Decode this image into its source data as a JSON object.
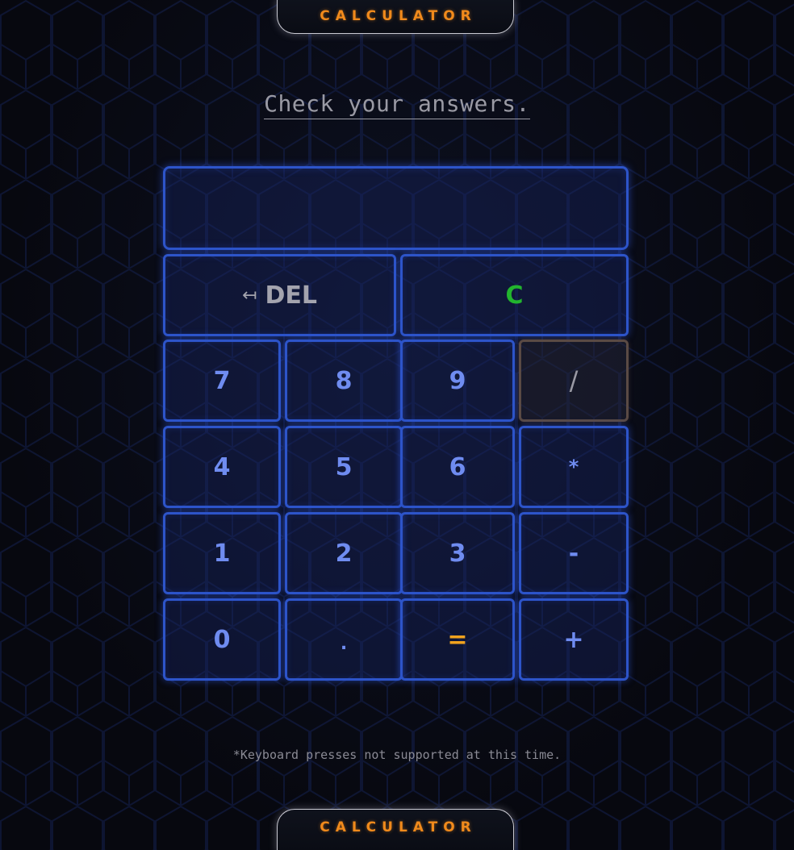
{
  "header": {
    "title": "CALCULATOR"
  },
  "heading": {
    "text": "Check your answers."
  },
  "display": {
    "value": ""
  },
  "keys": {
    "del_arrow": "↤",
    "del": "DEL",
    "clear": "C",
    "seven": "7",
    "eight": "8",
    "nine": "9",
    "divide": "/",
    "four": "4",
    "five": "5",
    "six": "6",
    "multiply": "*",
    "one": "1",
    "two": "2",
    "three": "3",
    "minus": "-",
    "zero": "0",
    "dot": ".",
    "equals": "=",
    "plus": "+"
  },
  "note": {
    "text": "*Keyboard presses not supported at this time."
  },
  "footer": {
    "title": "CALCULATOR"
  },
  "colors": {
    "background": "#07080f",
    "key_border": "#2d54c9",
    "key_text": "#6f8cf0",
    "brand": "#f08a1c",
    "clear": "#22b52e",
    "equals": "#f0a21e"
  }
}
